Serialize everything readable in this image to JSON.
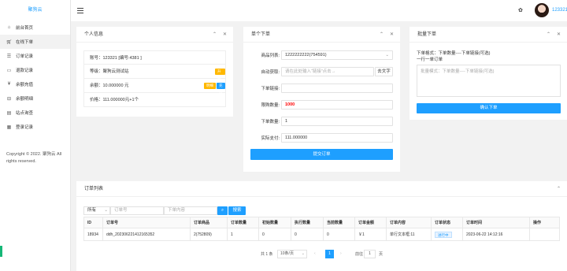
{
  "app": {
    "logo_text": "聚狗云"
  },
  "sidebar": {
    "items": [
      {
        "icon": "home-icon",
        "label": "前台首页"
      },
      {
        "icon": "cart-icon",
        "label": "在线下单"
      },
      {
        "icon": "list-icon",
        "label": "订单记录"
      },
      {
        "icon": "refund-icon",
        "label": "退款记录"
      },
      {
        "icon": "yen-icon",
        "label": "余额充值"
      },
      {
        "icon": "balance-detail-icon",
        "label": "余额明细"
      },
      {
        "icon": "site-query-icon",
        "label": "站点询查"
      },
      {
        "icon": "login-record-icon",
        "label": "登录记录"
      }
    ],
    "copyright": "Copyright © 2022. 聚狗云 All rights reserved."
  },
  "header": {
    "user_name": "123321"
  },
  "personal": {
    "title": "个人信息",
    "account": "账号：123321 [编号:4381 ]",
    "level": "等级：聚狗云测试站",
    "level_tag": "升级",
    "balance": "余额：10.000000 元",
    "balance_tag1": "明细",
    "balance_tag2": "充值",
    "price": "价格：111.000000元+1个"
  },
  "single_order": {
    "title": "单个下单",
    "product_label": "商品列表:",
    "product_value": "1222222222(754591)",
    "auto_label": "自动获取:",
    "auto_placeholder": "请在此处输入“链接”点击→",
    "auto_button": "去文字",
    "link_label": "下单链接:",
    "link_value": "",
    "qty_label": "限购数量:",
    "qty_value": "1000",
    "order_qty_label": "下单数量:",
    "order_qty_value": "1",
    "pay_label": "实际支付:",
    "pay_value": "111.000000",
    "submit": "提交订单"
  },
  "batch_order": {
    "title": "批量下单",
    "hint_line1": "下单格式：下单数量----下单链接(可选)",
    "hint_line2": "一行一单订单",
    "placeholder": "批量模式：下单数量----下单链接(可选)",
    "confirm": "确认下单"
  },
  "order_list": {
    "title": "订单列表",
    "filter_select": "所有",
    "order_no_placeholder": "订单号",
    "content_placeholder": "下单内容",
    "search_label": "搜索",
    "columns": [
      "ID",
      "订单号",
      "订单商品",
      "订单数量",
      "初始数量",
      "执行数量",
      "当前数量",
      "订单金额",
      "订单内容",
      "订单状态",
      "订单时间",
      "操作"
    ],
    "rows": [
      [
        "18934",
        "ddh_20230622141216535​2",
        "2(752809)",
        "1",
        "0",
        "0",
        "0",
        "￥1",
        "单行文本框:11",
        "进行中",
        "2023-06-22 14:12:16",
        ""
      ]
    ],
    "pager": {
      "total": "共 1 条",
      "page_size": "10条/页",
      "current": "1",
      "goto_label": "前往",
      "goto_value": "1",
      "page_unit": "页"
    }
  },
  "colors": {
    "accent": "#1e9fff",
    "orange": "#ffb800",
    "red": "#ff0000"
  }
}
